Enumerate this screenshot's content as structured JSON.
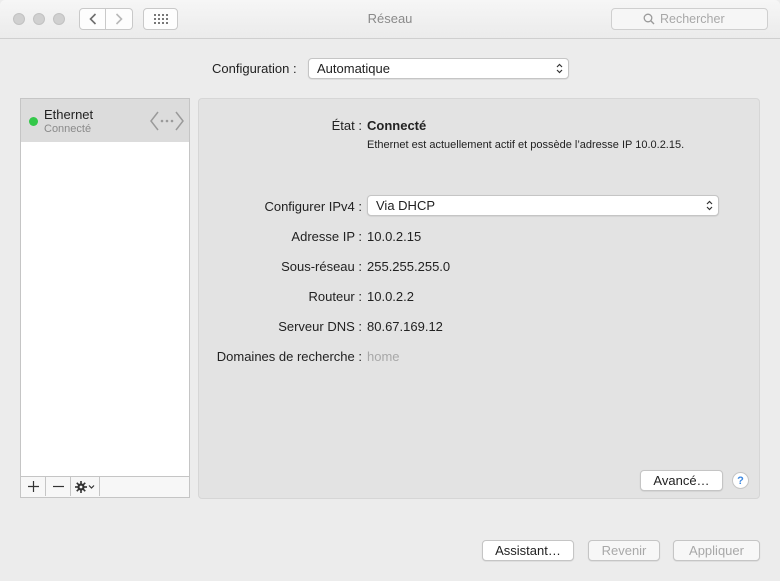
{
  "window": {
    "title": "Réseau"
  },
  "toolbar": {
    "search_placeholder": "Rechercher"
  },
  "config": {
    "label": "Configuration :",
    "value": "Automatique"
  },
  "sidebar": {
    "services": [
      {
        "name": "Ethernet",
        "status": "Connecté",
        "status_color": "#34c84a"
      }
    ]
  },
  "detail": {
    "state_label": "État :",
    "state_value": "Connecté",
    "state_description": "Ethernet est actuellement actif et possède l’adresse IP 10.0.2.15.",
    "ipv4_label": "Configurer IPv4 :",
    "ipv4_value": "Via DHCP",
    "ip_label": "Adresse IP :",
    "ip_value": "10.0.2.15",
    "subnet_label": "Sous-réseau :",
    "subnet_value": "255.255.255.0",
    "router_label": "Routeur :",
    "router_value": "10.0.2.2",
    "dns_label": "Serveur DNS :",
    "dns_value": "80.67.169.12",
    "search_domains_label": "Domaines de recherche :",
    "search_domains_value": "home",
    "advanced_button": "Avancé…",
    "help_button": "?"
  },
  "footer": {
    "assistant_button": "Assistant…",
    "revert_button": "Revenir",
    "apply_button": "Appliquer"
  },
  "icons": {
    "back": "chevron-left-icon",
    "forward": "chevron-right-icon",
    "grid": "grid-icon",
    "search": "search-icon",
    "ethernet": "ethernet-icon",
    "add": "plus-icon",
    "remove": "minus-icon",
    "gear": "gear-icon"
  }
}
